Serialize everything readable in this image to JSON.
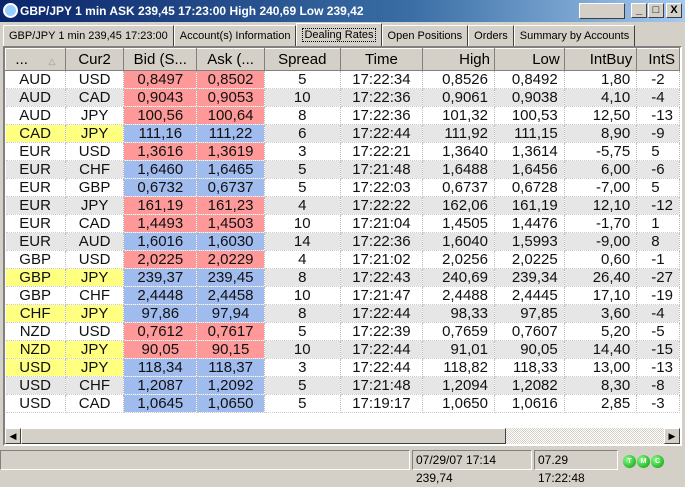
{
  "window": {
    "title": "GBP/JPY 1 min ASK 239,45 17:23:00 High 240,69 Low 239,42",
    "minimize": "_",
    "maximize": "□",
    "close": "X"
  },
  "tabs": [
    "GBP/JPY 1 min 239,45 17:23:00",
    "Account(s) Information",
    "Dealing Rates",
    "Open Positions",
    "Orders",
    "Summary by Accounts"
  ],
  "active_tab": 2,
  "columns": [
    "...",
    "Cur2",
    "Bid (S...",
    "Ask (...",
    "Spread",
    "Time",
    "High",
    "Low",
    "IntBuy",
    "IntS"
  ],
  "rows": [
    [
      "AUD",
      "USD",
      "0,8497",
      "0,8502",
      "5",
      "17:22:34",
      "0,8526",
      "0,8492",
      "1,80",
      "-2",
      "red",
      false
    ],
    [
      "AUD",
      "CAD",
      "0,9043",
      "0,9053",
      "10",
      "17:22:36",
      "0,9061",
      "0,9038",
      "4,10",
      "-4",
      "red",
      false
    ],
    [
      "AUD",
      "JPY",
      "100,56",
      "100,64",
      "8",
      "17:22:36",
      "101,32",
      "100,53",
      "12,50",
      "-13",
      "red",
      false
    ],
    [
      "CAD",
      "JPY",
      "111,16",
      "111,22",
      "6",
      "17:22:44",
      "111,92",
      "111,15",
      "8,90",
      "-9",
      "blue",
      true
    ],
    [
      "EUR",
      "USD",
      "1,3616",
      "1,3619",
      "3",
      "17:22:21",
      "1,3640",
      "1,3614",
      "-5,75",
      "5",
      "red",
      false
    ],
    [
      "EUR",
      "CHF",
      "1,6460",
      "1,6465",
      "5",
      "17:21:48",
      "1,6488",
      "1,6456",
      "6,00",
      "-6",
      "blue",
      false
    ],
    [
      "EUR",
      "GBP",
      "0,6732",
      "0,6737",
      "5",
      "17:22:03",
      "0,6737",
      "0,6728",
      "-7,00",
      "5",
      "blue",
      false
    ],
    [
      "EUR",
      "JPY",
      "161,19",
      "161,23",
      "4",
      "17:22:22",
      "162,06",
      "161,19",
      "12,10",
      "-12",
      "red",
      false
    ],
    [
      "EUR",
      "CAD",
      "1,4493",
      "1,4503",
      "10",
      "17:21:04",
      "1,4505",
      "1,4476",
      "-1,70",
      "1",
      "red",
      false
    ],
    [
      "EUR",
      "AUD",
      "1,6016",
      "1,6030",
      "14",
      "17:22:36",
      "1,6040",
      "1,5993",
      "-9,00",
      "8",
      "blue",
      false
    ],
    [
      "GBP",
      "USD",
      "2,0225",
      "2,0229",
      "4",
      "17:21:02",
      "2,0256",
      "2,0225",
      "0,60",
      "-1",
      "red",
      false
    ],
    [
      "GBP",
      "JPY",
      "239,37",
      "239,45",
      "8",
      "17:22:43",
      "240,69",
      "239,34",
      "26,40",
      "-27",
      "blue",
      true
    ],
    [
      "GBP",
      "CHF",
      "2,4448",
      "2,4458",
      "10",
      "17:21:47",
      "2,4488",
      "2,4445",
      "17,10",
      "-19",
      "blue",
      false
    ],
    [
      "CHF",
      "JPY",
      "97,86",
      "97,94",
      "8",
      "17:22:44",
      "98,33",
      "97,85",
      "3,60",
      "-4",
      "blue",
      true
    ],
    [
      "NZD",
      "USD",
      "0,7612",
      "0,7617",
      "5",
      "17:22:39",
      "0,7659",
      "0,7607",
      "5,20",
      "-5",
      "red",
      false
    ],
    [
      "NZD",
      "JPY",
      "90,05",
      "90,15",
      "10",
      "17:22:44",
      "91,01",
      "90,05",
      "14,40",
      "-15",
      "red",
      true
    ],
    [
      "USD",
      "JPY",
      "118,34",
      "118,37",
      "3",
      "17:22:44",
      "118,82",
      "118,33",
      "13,00",
      "-13",
      "blue",
      true
    ],
    [
      "USD",
      "CHF",
      "1,2087",
      "1,2092",
      "5",
      "17:21:48",
      "1,2094",
      "1,2082",
      "8,30",
      "-8",
      "blue",
      false
    ],
    [
      "USD",
      "CAD",
      "1,0645",
      "1,0650",
      "5",
      "17:19:17",
      "1,0650",
      "1,0616",
      "2,85",
      "-3",
      "blue",
      false
    ]
  ],
  "status": {
    "last_bar": "07/29/07 17:14  239,74",
    "server_time": "07.29 17:22:48",
    "leds": [
      "T",
      "M",
      "C"
    ]
  }
}
